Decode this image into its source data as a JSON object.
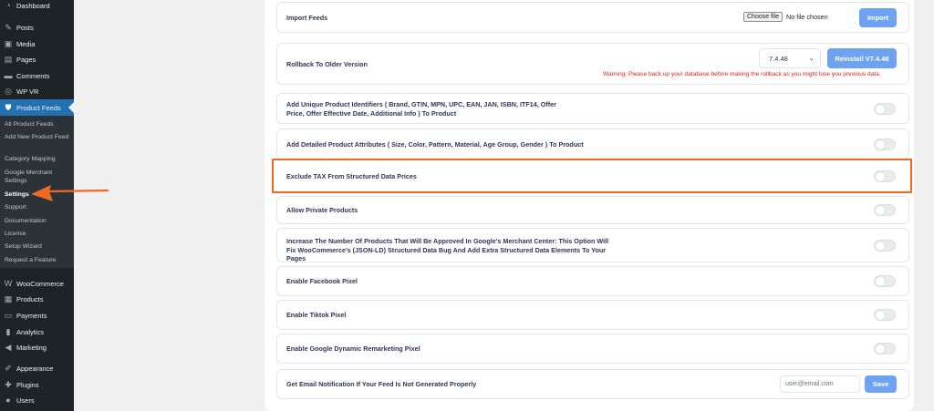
{
  "sidebar": {
    "items": [
      {
        "label": "Dashboard",
        "icon": "dashboard-icon",
        "glyph": "◔"
      },
      {
        "label": "Posts",
        "icon": "pin-icon",
        "glyph": "✎"
      },
      {
        "label": "Media",
        "icon": "media-icon",
        "glyph": "▣"
      },
      {
        "label": "Pages",
        "icon": "pages-icon",
        "glyph": "▤"
      },
      {
        "label": "Comments",
        "icon": "comments-icon",
        "glyph": "▬"
      },
      {
        "label": "WP VR",
        "icon": "vr-icon",
        "glyph": "◎"
      },
      {
        "label": "Product Feeds",
        "icon": "feed-icon",
        "glyph": "⛊"
      },
      {
        "label": "WooCommerce",
        "icon": "woocommerce-icon",
        "glyph": "W"
      },
      {
        "label": "Products",
        "icon": "products-icon",
        "glyph": "▦"
      },
      {
        "label": "Payments",
        "icon": "payments-icon",
        "glyph": "▭"
      },
      {
        "label": "Analytics",
        "icon": "analytics-icon",
        "glyph": "▮"
      },
      {
        "label": "Marketing",
        "icon": "marketing-icon",
        "glyph": "◀"
      },
      {
        "label": "Appearance",
        "icon": "appearance-icon",
        "glyph": "✐"
      },
      {
        "label": "Plugins",
        "icon": "plugins-icon",
        "glyph": "✚"
      },
      {
        "label": "Users",
        "icon": "users-icon",
        "glyph": "●"
      }
    ],
    "submenu": [
      "All Product Feeds",
      "Add New Product Feed",
      "Category Mapping",
      "Google Merchant Settings",
      "Settings",
      "Support",
      "Documentation",
      "License",
      "Setup Wizard",
      "Request a Feature"
    ]
  },
  "settings": {
    "import_label": "Import Feeds",
    "choose_file": "Choose file",
    "no_file": "No file chosen",
    "import_button": "Import",
    "rollback_label": "Rollback To Older Version",
    "version_selected": "7.4.48",
    "reinstall_button": "Reinstall V7.4.48",
    "warning": "Warning: Please back up your database before making the rollback as you might lose you previous data.",
    "unique_ids_label": "Add Unique Product Identifiers ( Brand, GTIN, MPN, UPC, EAN, JAN, ISBN, ITF14, Offer Price, Offer Effective Date, Additional Info ) To Product",
    "detailed_attrs_label": "Add Detailed Product Attributes ( Size, Color, Pattern, Material, Age Group, Gender ) To Product",
    "exclude_tax_label": "Exclude TAX From Structured Data Prices",
    "private_products_label": "Allow Private Products",
    "increase_products_label": "Increase The Number Of Products That Will Be Approved In Google's Merchant Center: This Option Will Fix WooCommerce's (JSON-LD) Structured Data Bug And Add Extra Structured Data Elements To Your Pages",
    "facebook_pixel_label": "Enable Facebook Pixel",
    "tiktok_pixel_label": "Enable Tiktok Pixel",
    "google_remarketing_label": "Enable Google Dynamic Remarketing Pixel",
    "email_notification_label": "Get Email Notification If Your Feed Is Not Generated Properly",
    "email_placeholder": "user@email.com",
    "save_button": "Save"
  },
  "colors": {
    "sidebar_bg": "#1d2327",
    "accent": "#2271b1",
    "button": "#6ea3f2",
    "highlight": "#f06822",
    "warning": "#e0201b"
  }
}
